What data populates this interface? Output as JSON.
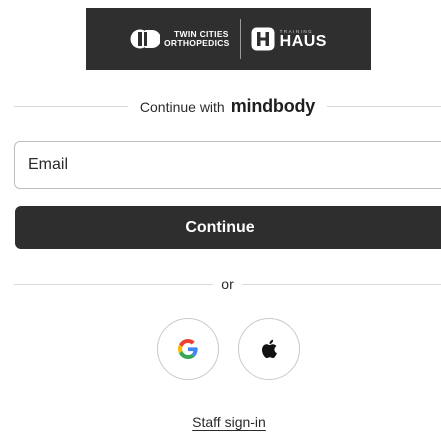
{
  "logo": {
    "left_brand_line1": "TWIN CITIES",
    "left_brand_line2": "ORTHOPEDICS",
    "right_brand_small": "TRAINING",
    "right_brand_big": "HAUS"
  },
  "continue_with": {
    "text": "Continue with",
    "brand": "mindbody"
  },
  "email": {
    "placeholder": "Email",
    "value": ""
  },
  "continue_button": {
    "label": "Continue"
  },
  "or_divider": {
    "label": "or"
  },
  "social": {
    "google_icon": "google-icon",
    "apple_icon": "apple-icon"
  },
  "staff_link": {
    "label": "Staff sign-in"
  },
  "colors": {
    "banner_bg": "#2f2f2f",
    "button_bg": "#2e2e2e",
    "border": "#bdbdbd",
    "text": "#2b2b2b"
  }
}
